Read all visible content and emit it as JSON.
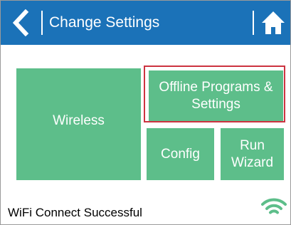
{
  "header": {
    "title": "Change Settings",
    "back_icon": "chevron-left-icon",
    "home_icon": "home-icon",
    "background_color": "#1b72b8"
  },
  "tiles": {
    "wireless_label": "Wireless",
    "offline_label_line1": "Offline Programs &",
    "offline_label_line2": "Settings",
    "config_label": "Config",
    "run_wizard_line1": "Run",
    "run_wizard_line2": "Wizard",
    "tile_color": "#5dbe8a",
    "highlight_color": "#cc3340"
  },
  "status": {
    "message": "WiFi Connect Successful",
    "wifi_icon": "wifi-icon",
    "wifi_color": "#5dbe8a"
  }
}
